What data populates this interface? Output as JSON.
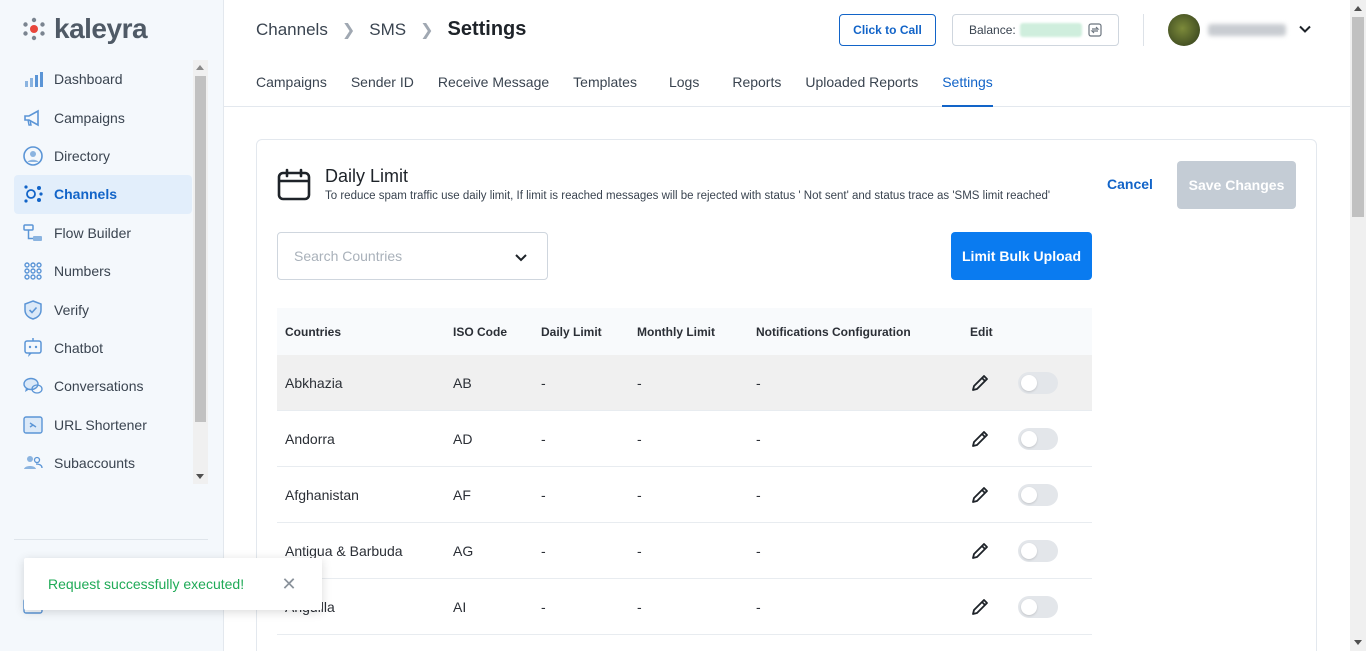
{
  "app": {
    "logo_text": "kaleyra"
  },
  "sidebar": {
    "items": [
      {
        "label": "Dashboard",
        "icon": "bar-chart-icon"
      },
      {
        "label": "Campaigns",
        "icon": "megaphone-icon"
      },
      {
        "label": "Directory",
        "icon": "contact-icon"
      },
      {
        "label": "Channels",
        "icon": "channels-icon",
        "active": true
      },
      {
        "label": "Flow Builder",
        "icon": "flow-icon"
      },
      {
        "label": "Numbers",
        "icon": "dial-pad-icon"
      },
      {
        "label": "Verify",
        "icon": "shield-check-icon"
      },
      {
        "label": "Chatbot",
        "icon": "chatbot-icon"
      },
      {
        "label": "Conversations",
        "icon": "chat-bubbles-icon"
      },
      {
        "label": "URL Shortener",
        "icon": "link-icon"
      },
      {
        "label": "Subaccounts",
        "icon": "users-icon"
      }
    ]
  },
  "toast": {
    "message": "Request successfully executed!"
  },
  "header": {
    "breadcrumb": [
      "Channels",
      "SMS",
      "Settings"
    ],
    "call_button": "Click to Call",
    "balance_label": "Balance:",
    "tabs": [
      "Campaigns",
      "Sender ID",
      "Receive Message",
      "Templates",
      "Logs",
      "Reports",
      "Uploaded Reports",
      "Settings"
    ],
    "active_tab": "Settings"
  },
  "card": {
    "title": "Daily Limit",
    "description": "To reduce spam traffic use daily limit, If limit is reached messages will be rejected with status ' Not sent' and status trace as 'SMS limit reached'",
    "cancel_label": "Cancel",
    "save_label": "Save Changes",
    "search_placeholder": "Search Countries",
    "bulk_upload_label": "Limit Bulk Upload"
  },
  "table": {
    "columns": [
      "Countries",
      "ISO Code",
      "Daily Limit",
      "Monthly Limit",
      "Notifications Configuration",
      "Edit"
    ],
    "rows": [
      {
        "country": "Abkhazia",
        "iso": "AB",
        "daily": "-",
        "monthly": "-",
        "notifications": "-"
      },
      {
        "country": "Andorra",
        "iso": "AD",
        "daily": "-",
        "monthly": "-",
        "notifications": "-"
      },
      {
        "country": "Afghanistan",
        "iso": "AF",
        "daily": "-",
        "monthly": "-",
        "notifications": "-"
      },
      {
        "country": "Antigua & Barbuda",
        "iso": "AG",
        "daily": "-",
        "monthly": "-",
        "notifications": "-"
      },
      {
        "country": "Anguilla",
        "iso": "AI",
        "daily": "-",
        "monthly": "-",
        "notifications": "-"
      }
    ]
  },
  "colors": {
    "primary": "#1264c8",
    "button_blue": "#0a7bf0",
    "success": "#1faa57",
    "disabled": "#c4ccd5"
  }
}
